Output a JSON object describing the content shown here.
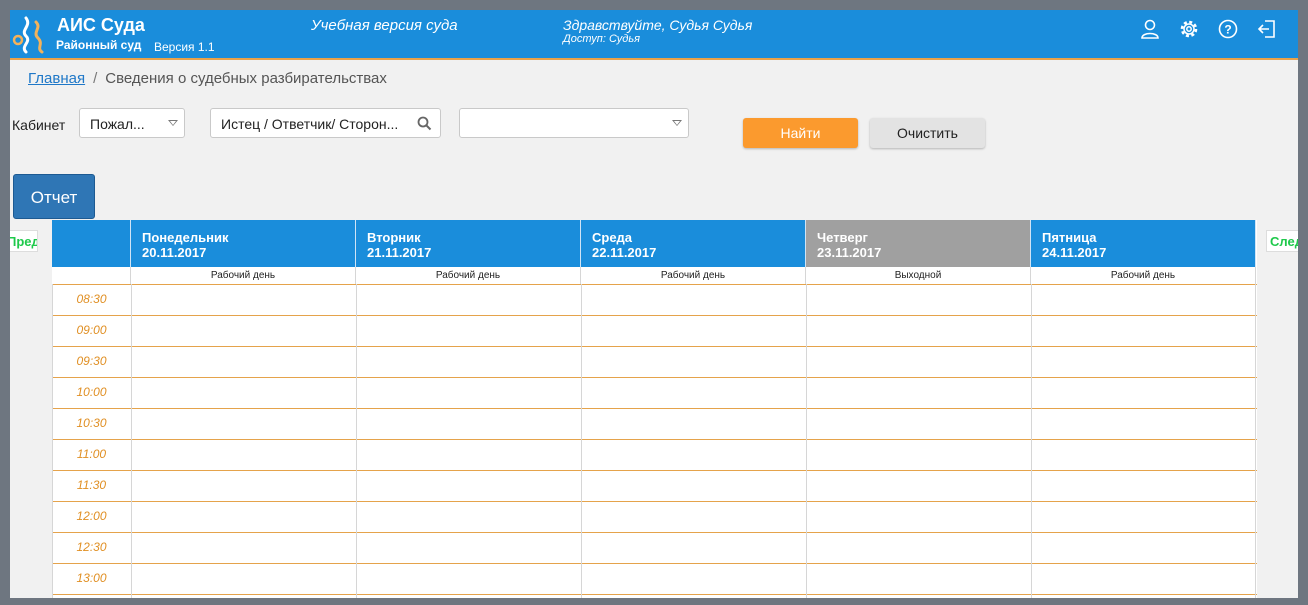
{
  "header": {
    "brand": "АИС Суда",
    "brand_sub": "Районный суд",
    "version": "Версия 1.1",
    "training": "Учебная версия суда",
    "greeting": "Здравствуйте, Судья Судья",
    "access": "Доступ: Судья",
    "icons": [
      "user-icon",
      "gear-icon",
      "help-icon",
      "logout-icon"
    ]
  },
  "breadcrumb": {
    "home": "Главная",
    "separator": "/",
    "current": "Сведения о судебных разбирательствах"
  },
  "filters": {
    "cabinet_label": "Кабинет",
    "cabinet_value": "Пожал...",
    "search_value": "Истец / Ответчик/ Сторон...",
    "third_value": "",
    "find_label": "Найти",
    "clear_label": "Очистить"
  },
  "report_label": "Отчет",
  "nav": {
    "prev": "Пред.",
    "next": "След."
  },
  "colors": {
    "accent": "#1a8ddb",
    "weekend": "#a0a0a0",
    "find": "#fb9a2e",
    "time": "#e08f23",
    "grid": "#e5a34b",
    "nav": "#1ec94b"
  },
  "days": [
    {
      "name": "Понедельник",
      "date": "20.11.2017",
      "status": "Рабочий день",
      "weekend": false
    },
    {
      "name": "Вторник",
      "date": "21.11.2017",
      "status": "Рабочий день",
      "weekend": false
    },
    {
      "name": "Среда",
      "date": "22.11.2017",
      "status": "Рабочий день",
      "weekend": false
    },
    {
      "name": "Четверг",
      "date": "23.11.2017",
      "status": "Выходной",
      "weekend": true
    },
    {
      "name": "Пятница",
      "date": "24.11.2017",
      "status": "Рабочий день",
      "weekend": false
    }
  ],
  "times": [
    "08:30",
    "09:00",
    "09:30",
    "10:00",
    "10:30",
    "11:00",
    "11:30",
    "12:00",
    "12:30",
    "13:00"
  ]
}
